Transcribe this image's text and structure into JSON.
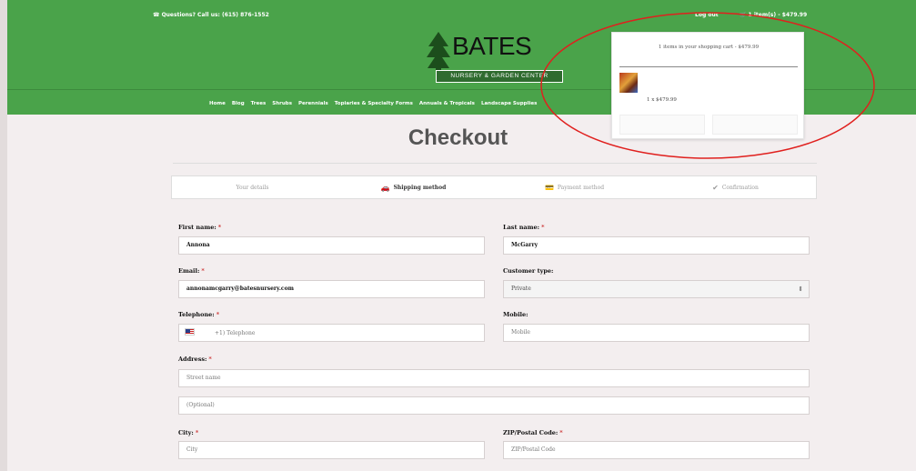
{
  "header": {
    "phone_text": "☎ Questions? Call us: (615) 876-1552",
    "login_label": "Log out",
    "cart_label": "🛒 1 item(s) - $479.99",
    "logo_title": "BATES",
    "logo_subtitle": "NURSERY & GARDEN CENTER",
    "nav_items": [
      "Home",
      "Blog",
      "Trees",
      "Shrubs",
      "Perennials",
      "Topiaries & Specialty Forms",
      "Annuals & Tropicals",
      "Landscape Supplies"
    ]
  },
  "page": {
    "title": "Checkout"
  },
  "steps": [
    {
      "label": "Your details",
      "icon": ""
    },
    {
      "label": "Shipping method",
      "icon": "🚗"
    },
    {
      "label": "Payment method",
      "icon": "💳"
    },
    {
      "label": "Confirmation",
      "icon": "✔"
    }
  ],
  "form": {
    "first_name": {
      "label": "First name:",
      "value": "Annona"
    },
    "last_name": {
      "label": "Last name:",
      "value": "McGarry"
    },
    "email": {
      "label": "Email:",
      "value": "annonamcgarry@batesnursery.com"
    },
    "customer_type": {
      "label": "Customer type:",
      "value": "Private"
    },
    "telephone": {
      "label": "Telephone:",
      "placeholder": "+1) Telephone"
    },
    "mobile": {
      "label": "Mobile:",
      "placeholder": "Mobile"
    },
    "address": {
      "label": "Address:",
      "street_placeholder": "Street name",
      "optional_placeholder": "(Optional)"
    },
    "city": {
      "label": "City:",
      "placeholder": "City"
    },
    "zip": {
      "label": "ZIP/Postal Code:",
      "placeholder": "ZIP/Postal Code"
    }
  },
  "cart_dropdown": {
    "summary": "1 items in your shopping cart - $479.99",
    "item_line": "1 x $479.99"
  },
  "colors": {
    "brand_green": "#4aa34a",
    "annotation_red": "#e0201e"
  }
}
